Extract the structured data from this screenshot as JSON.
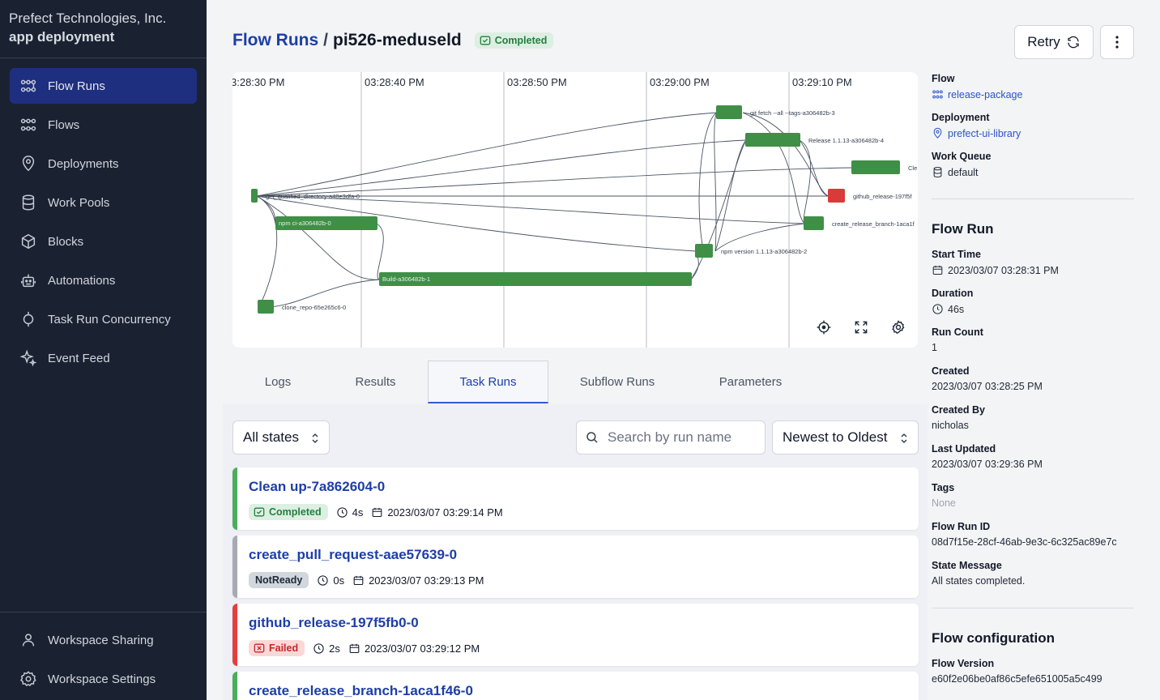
{
  "org": {
    "name": "Prefect Technologies, Inc.",
    "workspace": "app deployment"
  },
  "sidebar": {
    "items": [
      {
        "label": "Flow Runs",
        "icon": "flow-runs-icon",
        "active": true
      },
      {
        "label": "Flows",
        "icon": "flows-icon"
      },
      {
        "label": "Deployments",
        "icon": "map-pin-icon"
      },
      {
        "label": "Work Pools",
        "icon": "database-icon"
      },
      {
        "label": "Blocks",
        "icon": "cube-icon"
      },
      {
        "label": "Automations",
        "icon": "robot-icon"
      },
      {
        "label": "Task Run Concurrency",
        "icon": "concurrency-icon"
      },
      {
        "label": "Event Feed",
        "icon": "sparkles-icon"
      }
    ],
    "bottom": [
      {
        "label": "Workspace Sharing",
        "icon": "users-icon"
      },
      {
        "label": "Workspace Settings",
        "icon": "gear-icon"
      }
    ]
  },
  "header": {
    "breadcrumb_link": "Flow Runs",
    "separator": "/",
    "run_name": "pi526-meduseld",
    "state": "Completed",
    "retry_label": "Retry"
  },
  "graph": {
    "time_labels": [
      "3:28:30 PM",
      "03:28:40 PM",
      "03:28:50 PM",
      "03:29:00 PM",
      "03:29:10 PM"
    ],
    "nodes": [
      {
        "label": "get_qualified_directory-a48e3dfa-0",
        "state": "completed"
      },
      {
        "label": "npm ci-a306482b-0",
        "state": "completed"
      },
      {
        "label": "clone_repo-65e265c6-0",
        "state": "completed"
      },
      {
        "label": "Build-a306482b-1",
        "state": "completed"
      },
      {
        "label": "npm version 1.1.13-a306482b-2",
        "state": "completed"
      },
      {
        "label": "git fetch --all --tags-a306482b-3",
        "state": "completed"
      },
      {
        "label": "Release 1.1.13-a306482b-4",
        "state": "completed"
      },
      {
        "label": "Cle",
        "state": "completed"
      },
      {
        "label": "github_release-197f5f",
        "state": "failed"
      },
      {
        "label": "create_release_branch-1aca1f",
        "state": "completed"
      }
    ]
  },
  "tabs": [
    {
      "label": "Logs"
    },
    {
      "label": "Results"
    },
    {
      "label": "Task Runs",
      "active": true
    },
    {
      "label": "Subflow Runs"
    },
    {
      "label": "Parameters"
    }
  ],
  "filters": {
    "state_select": "All states",
    "search_placeholder": "Search by run name",
    "sort_select": "Newest to Oldest"
  },
  "task_runs": [
    {
      "name": "Clean up-7a862604-0",
      "state": "Completed",
      "duration": "4s",
      "timestamp": "2023/03/07 03:29:14 PM",
      "color": "#4cae5a"
    },
    {
      "name": "create_pull_request-aae57639-0",
      "state": "NotReady",
      "duration": "0s",
      "timestamp": "2023/03/07 03:29:13 PM",
      "color": "#9ca3af"
    },
    {
      "name": "github_release-197f5fb0-0",
      "state": "Failed",
      "duration": "2s",
      "timestamp": "2023/03/07 03:29:12 PM",
      "color": "#e53e3e"
    },
    {
      "name": "create_release_branch-1aca1f46-0",
      "state": "Completed",
      "duration": "",
      "timestamp": "",
      "color": "#4cae5a"
    }
  ],
  "details": {
    "flow_label": "Flow",
    "flow_value": "release-package",
    "deployment_label": "Deployment",
    "deployment_value": "prefect-ui-library",
    "work_queue_label": "Work Queue",
    "work_queue_value": "default",
    "flow_run_heading": "Flow Run",
    "start_time_label": "Start Time",
    "start_time_value": "2023/03/07 03:28:31 PM",
    "duration_label": "Duration",
    "duration_value": "46s",
    "run_count_label": "Run Count",
    "run_count_value": "1",
    "created_label": "Created",
    "created_value": "2023/03/07 03:28:25 PM",
    "created_by_label": "Created By",
    "created_by_value": "nicholas",
    "last_updated_label": "Last Updated",
    "last_updated_value": "2023/03/07 03:29:36 PM",
    "tags_label": "Tags",
    "tags_value": "None",
    "flow_run_id_label": "Flow Run ID",
    "flow_run_id_value": "08d7f15e-28cf-46ab-9e3c-6c325ac89e7c",
    "state_message_label": "State Message",
    "state_message_value": "All states completed.",
    "flow_config_heading": "Flow configuration",
    "flow_version_label": "Flow Version",
    "flow_version_value": "e60f2e06be0af86c5efe651005a5c499"
  },
  "colors": {
    "sidebar_bg": "#1a2232",
    "active_nav": "#1e2f80",
    "link": "#1d3ea8",
    "completed": "#3f8f47",
    "failed": "#d93a3a"
  }
}
